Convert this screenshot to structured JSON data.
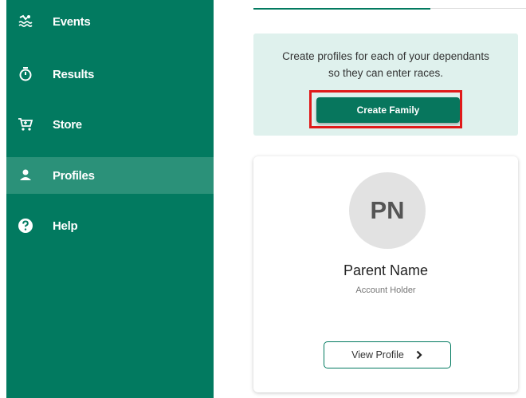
{
  "sidebar": {
    "items": [
      {
        "label": "Events",
        "icon": "swimmer-icon",
        "active": false
      },
      {
        "label": "Results",
        "icon": "stopwatch-icon",
        "active": false
      },
      {
        "label": "Store",
        "icon": "cart-icon",
        "active": false
      },
      {
        "label": "Profiles",
        "icon": "person-icon",
        "active": true
      },
      {
        "label": "Help",
        "icon": "help-icon",
        "active": false
      }
    ]
  },
  "info": {
    "line1": "Create profiles for each of your dependants",
    "line2": "so they can enter races.",
    "button": "Create Family"
  },
  "profile": {
    "initials": "PN",
    "name": "Parent Name",
    "role": "Account Holder",
    "button": "View Profile"
  },
  "colors": {
    "sidebar": "#027a60",
    "sidebar_active": "#2b9179",
    "info_bg": "#dff1ed",
    "button": "#07765d",
    "highlight": "#e01a1a"
  }
}
